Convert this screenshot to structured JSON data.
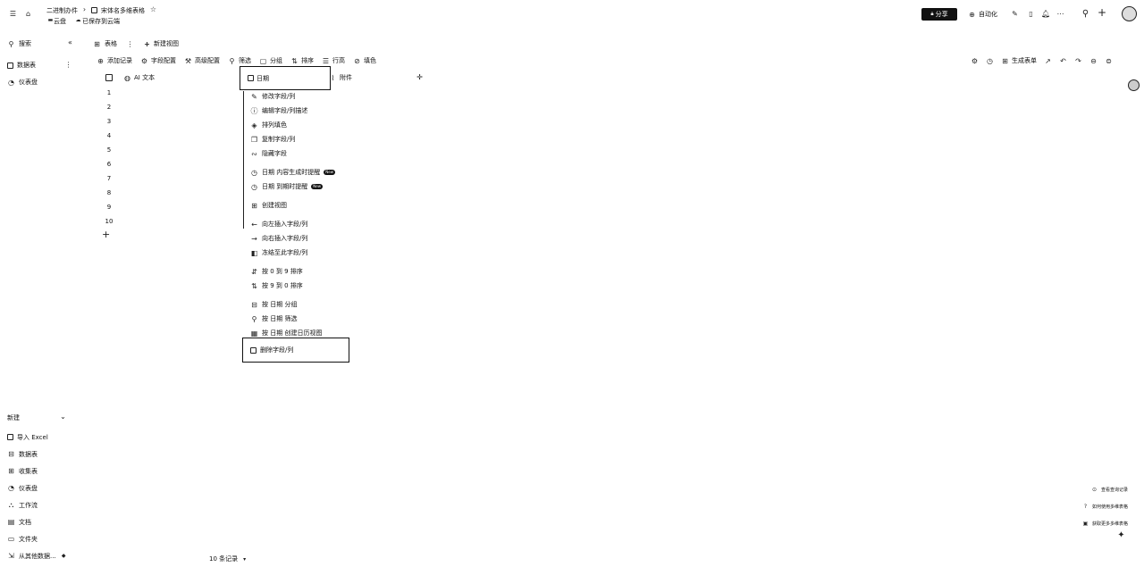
{
  "header": {
    "breadcrumb_parent": "二进制办件",
    "doc_title": "宋体名多维表格",
    "location": "云盘",
    "subtitle": "已保存到云端",
    "share_label": "分享",
    "automation_label": "自动化"
  },
  "view_bar": {
    "table_tab": "表格",
    "add_view": "新建视图"
  },
  "sidebar": {
    "search_label": "搜索",
    "items": [
      {
        "label": "数据表"
      },
      {
        "label": "仪表盘"
      }
    ],
    "new_section": "新建",
    "new_items": [
      {
        "label": "导入 Excel",
        "icon": "excel-icon"
      },
      {
        "label": "数据表",
        "icon": "table-icon"
      },
      {
        "label": "收集表",
        "icon": "form-icon"
      },
      {
        "label": "仪表盘",
        "icon": "dashboard-icon"
      },
      {
        "label": "工作流",
        "icon": "workflow-icon"
      },
      {
        "label": "文档",
        "icon": "doc-icon"
      },
      {
        "label": "文件夹",
        "icon": "folder-icon"
      },
      {
        "label": "从其他数据...",
        "icon": "import-icon"
      }
    ]
  },
  "toolbar": {
    "add_record": "添加记录",
    "field_config": "字段配置",
    "advanced_config": "高级配置",
    "filter": "筛选",
    "group": "分组",
    "sort": "排序",
    "row_height": "行高",
    "fill_color": "填色",
    "generate_form": "生成表单"
  },
  "grid": {
    "columns": [
      "AI 文本",
      "日期",
      "附件"
    ],
    "row_numbers": [
      "1",
      "2",
      "3",
      "4",
      "5",
      "6",
      "7",
      "8",
      "9",
      "10"
    ],
    "record_count": "10 条记录"
  },
  "context_menu": {
    "header_field": "日期",
    "groups": [
      [
        {
          "label": "修改字段/列",
          "icon": "pencil-icon"
        },
        {
          "label": "编辑字段/列描述",
          "icon": "info-icon"
        },
        {
          "label": "排列填色",
          "icon": "paint-icon"
        },
        {
          "label": "复制字段/列",
          "icon": "copy-icon"
        },
        {
          "label": "隐藏字段",
          "icon": "hide-icon"
        }
      ],
      [
        {
          "label": "日期 内容生成时提醒",
          "icon": "clock-icon",
          "badge": "New"
        },
        {
          "label": "日期 到期时提醒",
          "icon": "alarm-icon",
          "badge": "New"
        }
      ],
      [
        {
          "label": "创建视图",
          "icon": "view-icon"
        }
      ],
      [
        {
          "label": "向左插入字段/列",
          "icon": "arrow-left-icon"
        },
        {
          "label": "向右插入字段/列",
          "icon": "arrow-right-icon"
        },
        {
          "label": "冻结至此字段/列",
          "icon": "freeze-icon"
        }
      ],
      [
        {
          "label": "按 0 到 9 排序",
          "icon": "sort-asc-icon"
        },
        {
          "label": "按 9 到 0 排序",
          "icon": "sort-desc-icon"
        }
      ],
      [
        {
          "label": "按 日期 分组",
          "icon": "group-icon"
        },
        {
          "label": "按 日期 筛选",
          "icon": "filter-icon"
        },
        {
          "label": "按 日期 创建日历视图",
          "icon": "calendar-icon"
        }
      ]
    ],
    "delete_label": "删除字段/列"
  },
  "footer_right": {
    "items": [
      "查看查询记录",
      "如何使用多维表格",
      "获取更多多维表格"
    ]
  }
}
